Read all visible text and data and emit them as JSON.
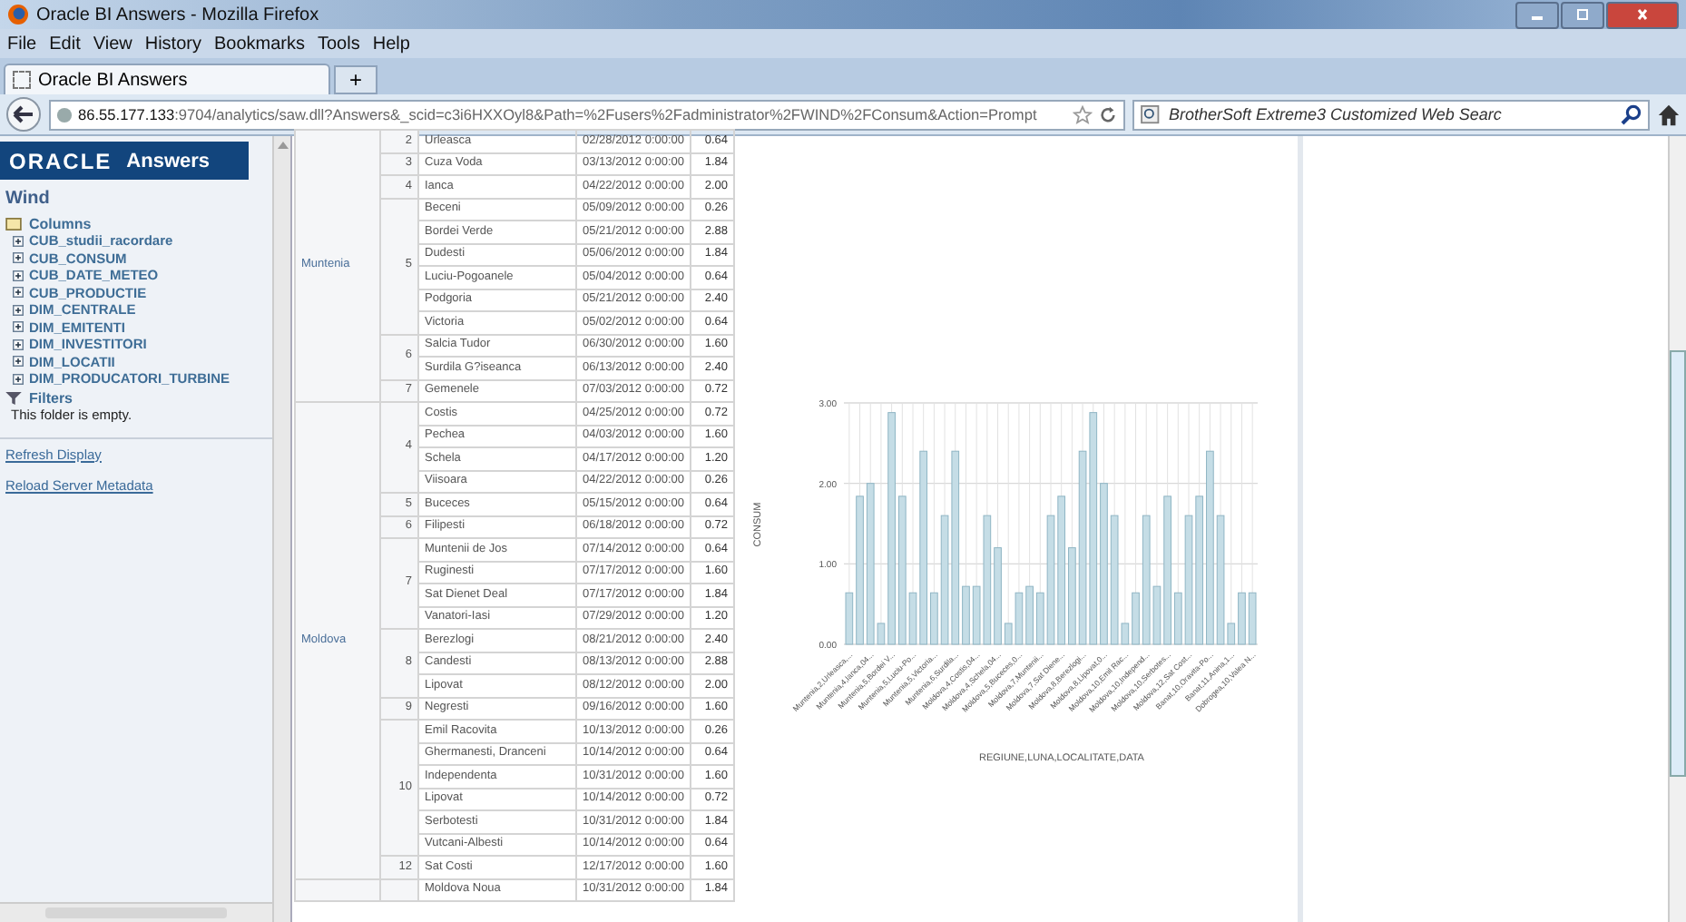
{
  "window": {
    "title": "Oracle BI Answers - Mozilla Firefox"
  },
  "menu": [
    "File",
    "Edit",
    "View",
    "History",
    "Bookmarks",
    "Tools",
    "Help"
  ],
  "tabs": [
    {
      "label": "Oracle BI Answers",
      "selected": true
    }
  ],
  "new_tab": "+",
  "address": {
    "host": "86.55.177.133",
    "rest": ":9704/analytics/saw.dll?Answers&_scid=c3i6HXXOyl8&Path=%2Fusers%2Fadministrator%2FWIND%2FConsum&Action=Prompt"
  },
  "search": {
    "placeholder": "BrotherSoft Extreme3 Customized Web Searc"
  },
  "sidebar": {
    "logo": "ORACLE",
    "product": "Answers",
    "subject": "Wind",
    "columns_label": "Columns",
    "columns": [
      "CUB_studii_racordare",
      "CUB_CONSUM",
      "CUB_DATE_METEO",
      "CUB_PRODUCTIE",
      "DIM_CENTRALE",
      "DIM_EMITENTI",
      "DIM_INVESTITORI",
      "DIM_LOCATII",
      "DIM_PRODUCATORI_TURBINE"
    ],
    "filters_label": "Filters",
    "filters_note": "This folder is empty.",
    "links": [
      "Refresh Display",
      "Reload Server Metadata"
    ]
  },
  "table": {
    "regions": [
      {
        "name": "Muntenia",
        "months": [
          {
            "month": "2",
            "rows": [
              [
                "Urleasca",
                "02/28/2012 0:00:00",
                "0.64"
              ]
            ]
          },
          {
            "month": "3",
            "rows": [
              [
                "Cuza Voda",
                "03/13/2012 0:00:00",
                "1.84"
              ]
            ]
          },
          {
            "month": "4",
            "rows": [
              [
                "Ianca",
                "04/22/2012 0:00:00",
                "2.00"
              ]
            ]
          },
          {
            "month": "5",
            "rows": [
              [
                "Beceni",
                "05/09/2012 0:00:00",
                "0.26"
              ],
              [
                "Bordei Verde",
                "05/21/2012 0:00:00",
                "2.88"
              ],
              [
                "Dudesti",
                "05/06/2012 0:00:00",
                "1.84"
              ],
              [
                "Luciu-Pogoanele",
                "05/04/2012 0:00:00",
                "0.64"
              ],
              [
                "Podgoria",
                "05/21/2012 0:00:00",
                "2.40"
              ],
              [
                "Victoria",
                "05/02/2012 0:00:00",
                "0.64"
              ]
            ]
          },
          {
            "month": "6",
            "rows": [
              [
                "Salcia Tudor",
                "06/30/2012 0:00:00",
                "1.60"
              ],
              [
                "Surdila G?iseanca",
                "06/13/2012 0:00:00",
                "2.40"
              ]
            ]
          },
          {
            "month": "7",
            "rows": [
              [
                "Gemenele",
                "07/03/2012 0:00:00",
                "0.72"
              ]
            ]
          }
        ]
      },
      {
        "name": "Moldova",
        "months": [
          {
            "month": "4",
            "rows": [
              [
                "Costis",
                "04/25/2012 0:00:00",
                "0.72"
              ],
              [
                "Pechea",
                "04/03/2012 0:00:00",
                "1.60"
              ],
              [
                "Schela",
                "04/17/2012 0:00:00",
                "1.20"
              ],
              [
                "Viisoara",
                "04/22/2012 0:00:00",
                "0.26"
              ]
            ]
          },
          {
            "month": "5",
            "rows": [
              [
                "Buceces",
                "05/15/2012 0:00:00",
                "0.64"
              ]
            ]
          },
          {
            "month": "6",
            "rows": [
              [
                "Filipesti",
                "06/18/2012 0:00:00",
                "0.72"
              ]
            ]
          },
          {
            "month": "7",
            "rows": [
              [
                "Muntenii de Jos",
                "07/14/2012 0:00:00",
                "0.64"
              ],
              [
                "Ruginesti",
                "07/17/2012 0:00:00",
                "1.60"
              ],
              [
                "Sat Dienet Deal",
                "07/17/2012 0:00:00",
                "1.84"
              ],
              [
                "Vanatori-Iasi",
                "07/29/2012 0:00:00",
                "1.20"
              ]
            ]
          },
          {
            "month": "8",
            "rows": [
              [
                "Berezlogi",
                "08/21/2012 0:00:00",
                "2.40"
              ],
              [
                "Candesti",
                "08/13/2012 0:00:00",
                "2.88"
              ],
              [
                "Lipovat",
                "08/12/2012 0:00:00",
                "2.00"
              ]
            ]
          },
          {
            "month": "9",
            "rows": [
              [
                "Negresti",
                "09/16/2012 0:00:00",
                "1.60"
              ]
            ]
          },
          {
            "month": "10",
            "rows": [
              [
                "Emil Racovita",
                "10/13/2012 0:00:00",
                "0.26"
              ],
              [
                "Ghermanesti, Dranceni",
                "10/14/2012 0:00:00",
                "0.64"
              ],
              [
                "Independenta",
                "10/31/2012 0:00:00",
                "1.60"
              ],
              [
                "Lipovat",
                "10/14/2012 0:00:00",
                "0.72"
              ],
              [
                "Serbotesti",
                "10/31/2012 0:00:00",
                "1.84"
              ],
              [
                "Vutcani-Albesti",
                "10/14/2012 0:00:00",
                "0.64"
              ]
            ]
          },
          {
            "month": "12",
            "rows": [
              [
                "Sat Costi",
                "12/17/2012 0:00:00",
                "1.60"
              ]
            ]
          }
        ]
      },
      {
        "months": [
          {
            "rows": [
              [
                "Moldova Noua",
                "10/31/2012 0:00:00",
                "1.84"
              ]
            ]
          }
        ]
      }
    ]
  },
  "chart": {
    "chart_data": {
      "type": "bar",
      "xlabel": "REGIUNE,LUNA,LOCALITATE,DATA",
      "ylabel": "CONSUM",
      "categories": [
        "Muntenia,2,Urleasca,...",
        null,
        "Muntenia,4,Ianca,04...",
        null,
        "Muntenia,5,Bordei V...",
        null,
        "Muntenia,5,Luciu-Po...",
        null,
        "Muntenia,5,Victoria...",
        null,
        "Muntenia,6,Surdila...",
        null,
        "Moldova,4,Costis,04...",
        null,
        "Moldova,4,Schela,04...",
        null,
        "Moldova,5,Buceces,0...",
        null,
        "Moldova,7,Muntenii...",
        null,
        "Moldova,7,Sat Diene...",
        null,
        "Moldova,8,Berezlogi...",
        null,
        "Moldova,8,Lipovat,0...",
        null,
        "Moldova,10,Emil Rac...",
        null,
        "Moldova,10,Independ...",
        null,
        "Moldova,10,Serbotes...",
        null,
        "Moldova,12,Sat Cost...",
        null,
        "Banat,10,Oravita-Po...",
        null,
        "Banat,11,Anina,1...",
        null,
        "Dobrogea,10,Valea N..."
      ],
      "values": [
        0.64,
        1.84,
        2.0,
        0.26,
        2.88,
        1.84,
        0.64,
        2.4,
        0.64,
        1.6,
        2.4,
        0.72,
        0.72,
        1.6,
        1.2,
        0.26,
        0.64,
        0.72,
        0.64,
        1.6,
        1.84,
        1.2,
        2.4,
        2.88,
        2.0,
        1.6,
        0.26,
        0.64,
        1.6,
        0.72,
        1.84,
        0.64,
        1.6,
        1.84,
        2.4,
        1.6,
        0.26,
        0.64,
        0.64
      ],
      "ylim": [
        0,
        3
      ],
      "grid": true,
      "yticks": [
        {
          "value": 0,
          "label": "0.00"
        },
        {
          "value": 1,
          "label": "1.00"
        },
        {
          "value": 2,
          "label": "2.00"
        },
        {
          "value": 3,
          "label": "3.00"
        }
      ]
    }
  }
}
